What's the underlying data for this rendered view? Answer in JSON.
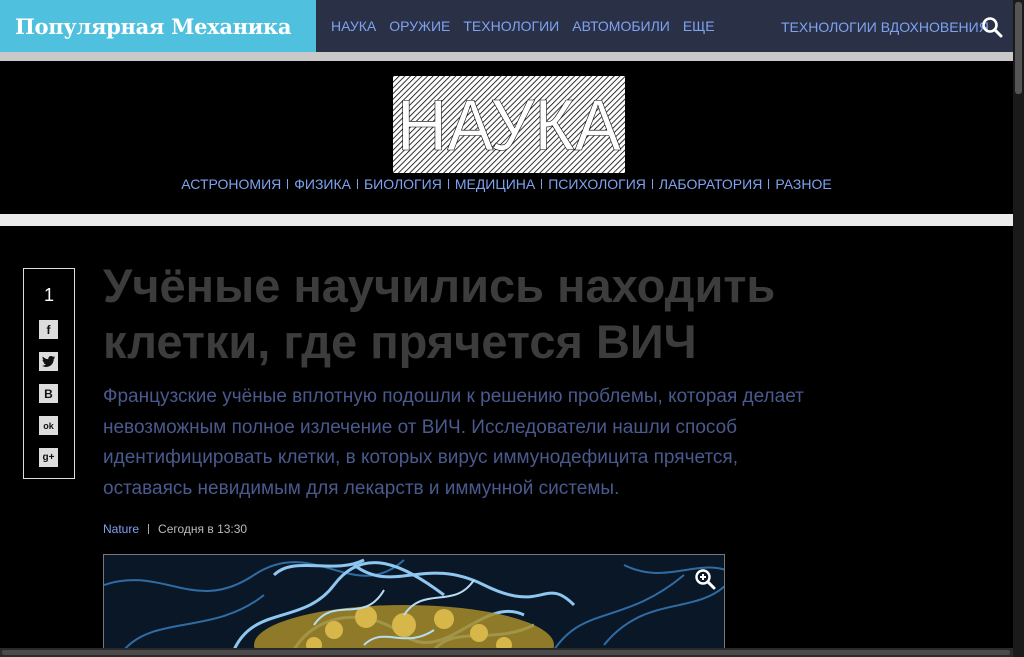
{
  "header": {
    "logo_text": "Популярная Механика",
    "nav": [
      "НАУКА",
      "ОРУЖИЕ",
      "ТЕХНОЛОГИИ",
      "АВТОМОБИЛИ",
      "ЕЩЕ"
    ],
    "nav_right": "ТЕХНОЛОГИИ ВДОХНОВЕНИЯ",
    "search_icon": "search-icon",
    "brand_color": "#4fc1de",
    "bar_color": "#2a3146"
  },
  "section": {
    "title": "НАУКА",
    "subnav": [
      "АСТРОНОМИЯ",
      "ФИЗИКА",
      "БИОЛОГИЯ",
      "МЕДИЦИНА",
      "ПСИХОЛОГИЯ",
      "ЛАБОРАТОРИЯ",
      "РАЗНОЕ"
    ]
  },
  "share": {
    "count": "1",
    "buttons": [
      {
        "icon": "facebook-icon",
        "glyph": "f"
      },
      {
        "icon": "twitter-icon",
        "glyph": "t"
      },
      {
        "icon": "vkontakte-icon",
        "glyph": "В"
      },
      {
        "icon": "odnoklassniki-icon",
        "glyph": "ok"
      },
      {
        "icon": "google-plus-icon",
        "glyph": "g+"
      }
    ]
  },
  "article": {
    "headline": "Учёные научились находить клетки, где прячется ВИЧ",
    "lead": "Французские учёные вплотную подошли к решению проблемы, которая делает невозможным полное излечение от ВИЧ. Исследователи нашли способ идентифицировать клетки, в которых вирус иммунодефицита прячется, оставаясь невидимым для лекарств и иммунной системы.",
    "source": "Nature",
    "time": "Сегодня в 13:30",
    "image_icon": "zoom-in-icon"
  }
}
